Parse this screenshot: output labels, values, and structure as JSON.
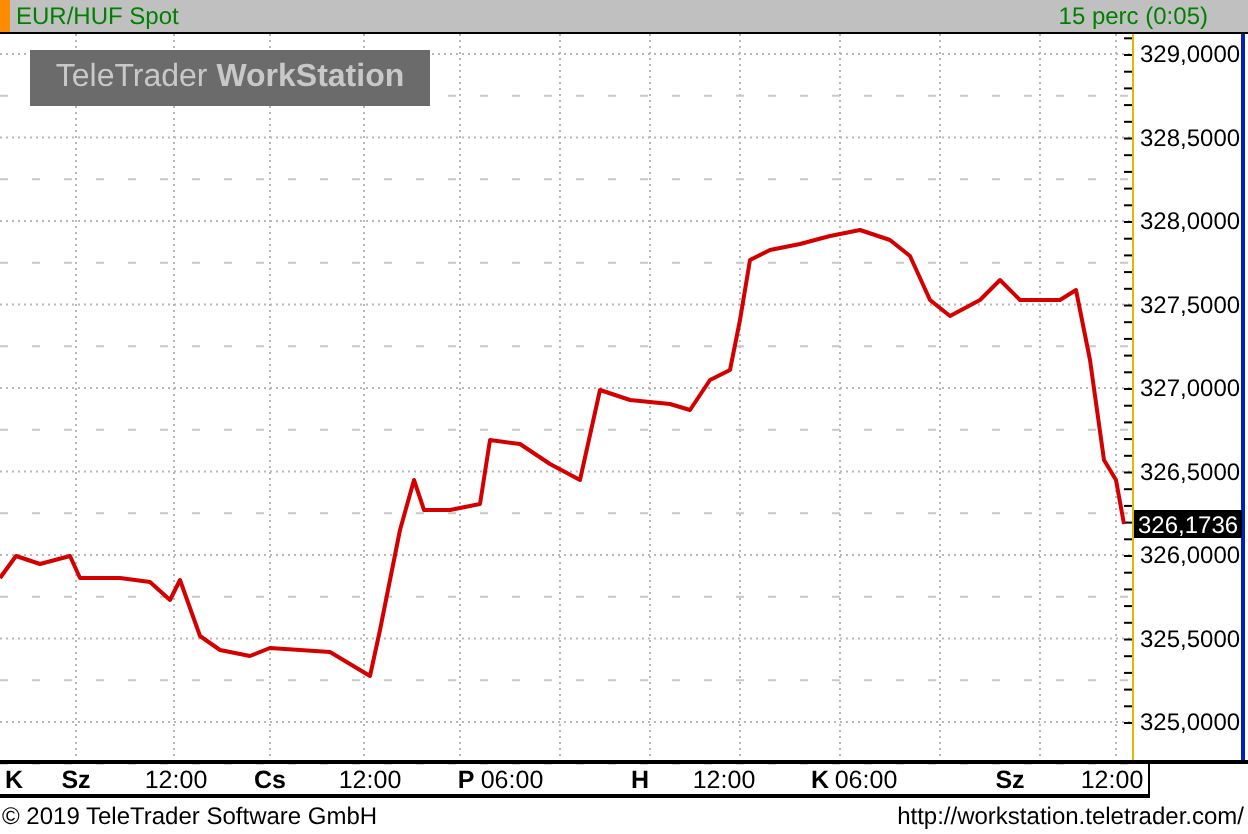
{
  "header": {
    "title": "EUR/HUF Spot",
    "interval": "15 perc (0:05)"
  },
  "logo": "TeleTrader **WorkStation**",
  "chart": {
    "last_price": "326,1736",
    "y_axis": {
      "labels": [
        "329,0000",
        "328,5000",
        "328,0000",
        "327,5000",
        "327,0000",
        "326,5000",
        "326,0000",
        "325,5000",
        "325,0000"
      ]
    },
    "x_axis": {
      "labels": [
        {
          "text": "K",
          "bold": true
        },
        {
          "text": "Sz",
          "bold": true
        },
        {
          "text": "12:00",
          "bold": false
        },
        {
          "text": "Cs",
          "bold": true
        },
        {
          "text": "12:00",
          "bold": false
        },
        {
          "text": "P",
          "bold": true
        },
        {
          "text": "06:00",
          "bold": false
        },
        {
          "text": "H",
          "bold": true
        },
        {
          "text": "12:00",
          "bold": false
        },
        {
          "text": "K",
          "bold": true
        },
        {
          "text": "06:00",
          "bold": false
        },
        {
          "text": "Sz",
          "bold": true
        },
        {
          "text": "12:00",
          "bold": false
        }
      ]
    }
  },
  "footer": {
    "copyright": "© 2019 TeleTrader Software GmbH",
    "url": "http://workstation.teletrader.com/"
  }
}
